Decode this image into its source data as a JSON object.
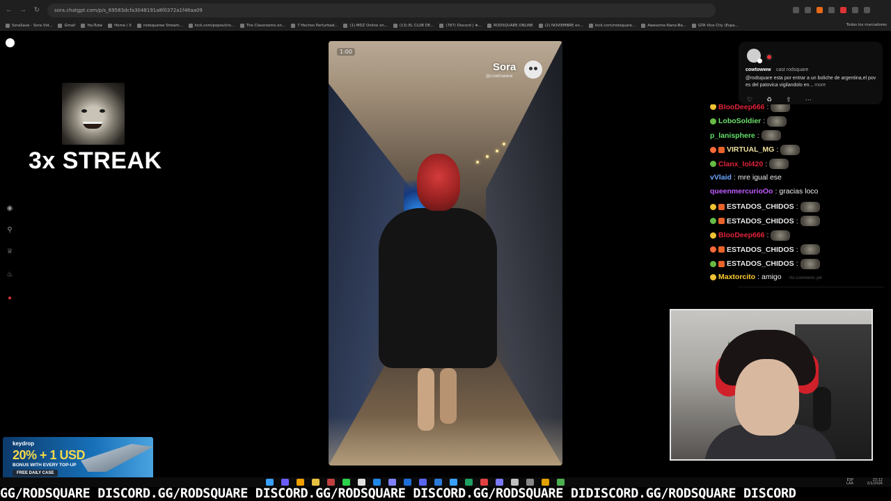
{
  "browser": {
    "url": "sora.chatgpt.com/p/s_69583dcfa3048191a8f0372a1f46aa09",
    "bookmarks": [
      "SoraSave - Sora Vid...",
      "Gmail",
      "YouTube",
      "Home / X",
      "rodsquaree Stream...",
      "kick.com/popout/ro...",
      "The Classrooms en...",
      "7 Hechos Perturbad...",
      "(1) MDZ Online on...",
      "(13) EL CLUB DE...",
      "(787) Discord | ★...",
      "RODSQUARE.ONLINE",
      "(2) NOVIEMBRE en...",
      "kick.com/rodsquare...",
      "Awesome-Nano-Ba...",
      "GTA Vice City (Espa..."
    ],
    "all_bookmarks": "Todos los marcadores"
  },
  "streak": {
    "label": "3x STREAK"
  },
  "video": {
    "timestamp": "1:00",
    "watermark": "Sora",
    "watermark_handle": "@cowtowww"
  },
  "post": {
    "author": "cowtowww",
    "cast": "cast rodsquare",
    "caption": "@rodsquare esta por entrar a un boliche de argentina,el pov es del patovica vigilandolo en...",
    "more": "more"
  },
  "chat": {
    "messages": [
      {
        "user": "BlooDeep666",
        "color": "#e0233a",
        "text": "",
        "emote": true
      },
      {
        "user": "LoboSoldier",
        "color": "#6fe06f",
        "text": "",
        "emote": true
      },
      {
        "user": "p_lanisphere",
        "color": "#62e06a",
        "text": "",
        "emote": true
      },
      {
        "user": "VIRTUAL_MG",
        "color": "#f0e0a0",
        "text": "",
        "emote": true
      },
      {
        "user": "Clanx_lol420",
        "color": "#e0233a",
        "text": "",
        "emote": true
      },
      {
        "user": "vVlaid",
        "color": "#6aa7ff",
        "text": "mre igual ese",
        "emote": false
      },
      {
        "user": "queenmercurioOo",
        "color": "#c05cff",
        "text": "gracias loco",
        "emote": false
      },
      {
        "user": "ESTADOS_CHIDOS",
        "color": "#e8e8e8",
        "text": "",
        "emote": true
      },
      {
        "user": "ESTADOS_CHIDOS",
        "color": "#e8e8e8",
        "text": "",
        "emote": true
      },
      {
        "user": "BlooDeep666",
        "color": "#e0233a",
        "text": "",
        "emote": true
      },
      {
        "user": "ESTADOS_CHIDOS",
        "color": "#e8e8e8",
        "text": "",
        "emote": true
      },
      {
        "user": "ESTADOS_CHIDOS",
        "color": "#e8e8e8",
        "text": "",
        "emote": true
      },
      {
        "user": "Maxtorcito",
        "color": "#ffcc33",
        "text": "amigo",
        "emote": false
      }
    ],
    "no_comments": "No comments yet"
  },
  "ad": {
    "brand": "keydrop",
    "headline": "20% + 1 USD",
    "subline": "BONUS WITH EVERY TOP-UP",
    "cta": "FREE DAILY CASE"
  },
  "taskbar": {
    "lang_line1": "ESP",
    "lang_line2": "LAA",
    "time": "23:12",
    "date": "2/1/2026"
  },
  "ticker": {
    "text": "GG/RODSQUARE DISCORD.GG/RODSQUARE DISCORD.GG/RODSQUARE DISCORD.GG/RODSQUARE DIDISCORD.GG/RODSQUARE DISCORD"
  },
  "colors": {
    "background": "#000000",
    "chrome": "#1f1f1f",
    "accent_red": "#e0233a"
  },
  "icons": {
    "sidebar": [
      "sora-logo-icon",
      "home-icon",
      "search-icon",
      "trophy-icon",
      "bell-icon",
      "profile-icon"
    ],
    "post_actions": [
      "heart-icon",
      "remix-icon",
      "share-icon",
      "more-icon"
    ]
  }
}
